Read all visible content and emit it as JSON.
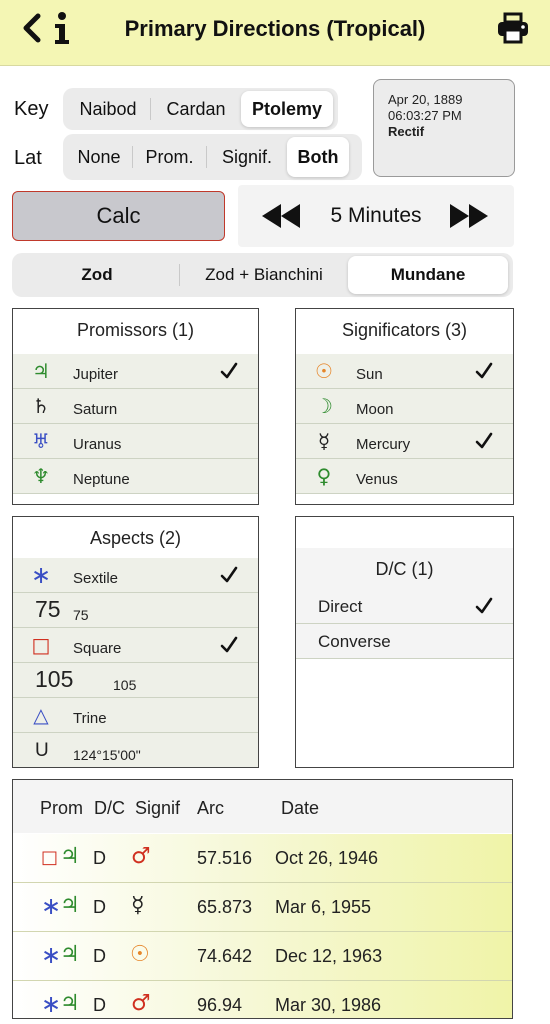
{
  "header": {
    "title": "Primary Directions (Tropical)"
  },
  "key": {
    "label": "Key",
    "options": [
      "Naibod",
      "Cardan",
      "Ptolemy"
    ],
    "selected": "Ptolemy"
  },
  "lat": {
    "label": "Lat",
    "options": [
      "None",
      "Prom.",
      "Signif.",
      "Both"
    ],
    "selected": "Both"
  },
  "datebox": {
    "date": "Apr 20, 1889",
    "time": "06:03:27 PM",
    "note": "Rectif"
  },
  "calc": {
    "label": "Calc"
  },
  "step": {
    "label": "5 Minutes"
  },
  "mode": {
    "options": [
      "Zod",
      "Zod + Bianchini",
      "Mundane"
    ],
    "selected": "Mundane"
  },
  "promissors": {
    "title": "Promissors (1)",
    "items": [
      {
        "symbol": "♃",
        "label": "Jupiter",
        "checked": true,
        "color": "#2e8b2e"
      },
      {
        "symbol": "♄",
        "label": "Saturn",
        "checked": false,
        "color": "#222222"
      },
      {
        "symbol": "♅",
        "label": "Uranus",
        "checked": false,
        "color": "#3a4fc4"
      },
      {
        "symbol": "♆",
        "label": "Neptune",
        "checked": false,
        "color": "#2e8b2e"
      }
    ]
  },
  "significators": {
    "title": "Significators (3)",
    "items": [
      {
        "symbol": "☉",
        "label": "Sun",
        "checked": true,
        "color": "#e6862a"
      },
      {
        "symbol": "☽",
        "label": "Moon",
        "checked": false,
        "color": "#2e8b2e"
      },
      {
        "symbol": "☿",
        "label": "Mercury",
        "checked": true,
        "color": "#222222"
      },
      {
        "symbol": "♀",
        "label": "Venus",
        "checked": false,
        "color": "#2e8b2e"
      }
    ]
  },
  "aspects": {
    "title": "Aspects (2)",
    "items": [
      {
        "symbol": "∗",
        "label": "Sextile",
        "checked": true,
        "kind": "icon",
        "color": "#3a4fc4"
      },
      {
        "big": "75",
        "label": "75",
        "kind": "number"
      },
      {
        "symbol": "□",
        "label": "Square",
        "checked": true,
        "kind": "icon",
        "color": "#d03020"
      },
      {
        "big": "105",
        "label": "105",
        "kind": "number"
      },
      {
        "symbol": "△",
        "label": "Trine",
        "checked": false,
        "kind": "icon",
        "color": "#3a4fc4"
      },
      {
        "big": "U",
        "label": "124°15'00\"",
        "kind": "number"
      }
    ]
  },
  "dc": {
    "title": "D/C (1)",
    "items": [
      {
        "label": "Direct",
        "checked": true
      },
      {
        "label": "Converse",
        "checked": false
      }
    ]
  },
  "results": {
    "columns": [
      "Prom",
      "D/C",
      "Signif",
      "Arc",
      "Date"
    ],
    "rows": [
      {
        "aspect": "□",
        "aspect_color": "#d03020",
        "prom": "♃",
        "dc": "D",
        "signif": "♂",
        "signif_color": "#d03020",
        "arc": "57.516",
        "date": "Oct 26, 1946"
      },
      {
        "aspect": "∗",
        "aspect_color": "#3a4fc4",
        "prom": "♃",
        "dc": "D",
        "signif": "☿",
        "signif_color": "#222222",
        "arc": "65.873",
        "date": "Mar 6, 1955"
      },
      {
        "aspect": "∗",
        "aspect_color": "#3a4fc4",
        "prom": "♃",
        "dc": "D",
        "signif": "☉",
        "signif_color": "#e6862a",
        "arc": "74.642",
        "date": "Dec 12, 1963"
      },
      {
        "aspect": "∗",
        "aspect_color": "#3a4fc4",
        "prom": "♃",
        "dc": "D",
        "signif": "♂",
        "signif_color": "#d03020",
        "arc": "96.94",
        "date": "Mar 30, 1986"
      }
    ]
  },
  "colors": {
    "header_bg": "#f4f6b4",
    "jupiter_green": "#2e8b2e",
    "accent_red": "#d03020",
    "aspect_blue": "#3a4fc4"
  }
}
